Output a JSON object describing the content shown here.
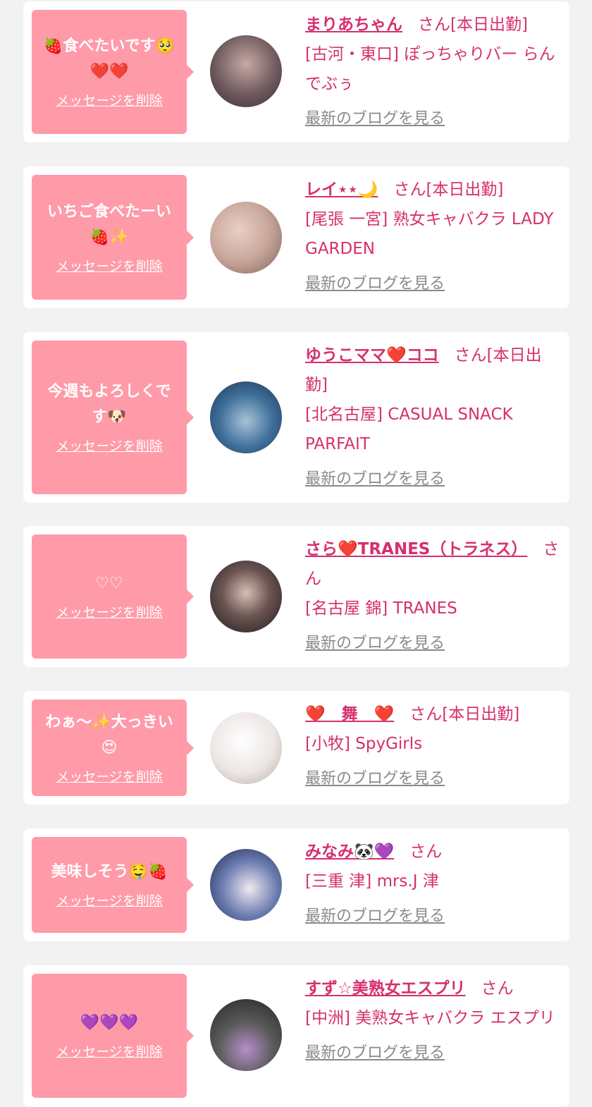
{
  "delete_label": "メッセージを削除",
  "blog_label": "最新のブログを見る",
  "cards": [
    {
      "message": "🍓食べたいです🥺\n❤️❤️",
      "name": "まりあちゃん",
      "suffix": "さん[本日出勤]",
      "shop": "[古河・東口] ぽっちゃりバー らんでぶぅ",
      "avatar_colors": [
        "#5b4a4f",
        "#c8a9a4"
      ]
    },
    {
      "message": "いちご食べたーい\n🍓✨",
      "name": "レイ⋆⋆🌙",
      "suffix": "さん[本日出勤]",
      "shop": "[尾張 一宮] 熟女キャバクラ LADY GARDEN",
      "avatar_colors": [
        "#d9b3a8",
        "#8b6f67"
      ]
    },
    {
      "message": "今週もよろしくで\nす🐶",
      "name": "ゆうこママ❤️ココ",
      "suffix": "さん[本日出勤]",
      "shop": "[北名古屋] CASUAL SNACK PARFAIT",
      "avatar_colors": [
        "#2f5d8a",
        "#a7c3d8"
      ]
    },
    {
      "message": "♡♡",
      "name": "さら❤️TRANES（トラネス）",
      "suffix": "さん",
      "shop": "[名古屋 錦] TRANES",
      "avatar_colors": [
        "#2a2426",
        "#b99c95"
      ]
    },
    {
      "message": "わぁ〜✨大っきい\n😍",
      "name": "❤️　舞　❤️",
      "suffix": "さん[本日出勤]",
      "shop": "[小牧] SpyGirls",
      "avatar_colors": [
        "#f4f1f0",
        "#c7b6b0"
      ]
    },
    {
      "message": "美味しそう🤤🍓",
      "name": "みなみ🐼💜",
      "suffix": "さん",
      "shop": "[三重 津] mrs.J 津",
      "avatar_colors": [
        "#2c3a66",
        "#d9d6e4"
      ]
    },
    {
      "message": "💜💜💜",
      "name": "すず☆美熟女エスプリ",
      "suffix": "さん",
      "shop": "[中洲] 美熟女キャバクラ エスプリ",
      "avatar_colors": [
        "#3b3b3b",
        "#8c8c8c"
      ]
    }
  ]
}
